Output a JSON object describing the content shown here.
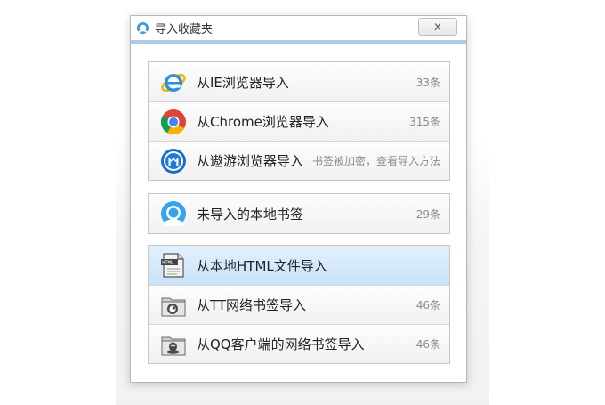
{
  "dialog": {
    "title": "导入收藏夹",
    "close_label": "x"
  },
  "groups": [
    {
      "items": [
        {
          "label": "从IE浏览器导入",
          "count": "33条",
          "icon": "ie-icon"
        },
        {
          "label": "从Chrome浏览器导入",
          "count": "315条",
          "icon": "chrome-icon"
        },
        {
          "label": "从遨游浏览器导入",
          "count": "书签被加密，查看导入方法",
          "icon": "maxthon-icon"
        }
      ]
    },
    {
      "items": [
        {
          "label": "未导入的本地书签",
          "count": "29条",
          "icon": "local-bookmark-icon"
        }
      ]
    },
    {
      "items": [
        {
          "label": "从本地HTML文件导入",
          "count": "",
          "icon": "html-file-icon",
          "selected": true
        },
        {
          "label": "从TT网络书签导入",
          "count": "46条",
          "icon": "tt-folder-icon"
        },
        {
          "label": "从QQ客户端的网络书签导入",
          "count": "46条",
          "icon": "qq-folder-icon"
        }
      ]
    }
  ],
  "colors": {
    "titlebar_accent": "#a9cdea",
    "selected_row": "#c8e2f9"
  }
}
